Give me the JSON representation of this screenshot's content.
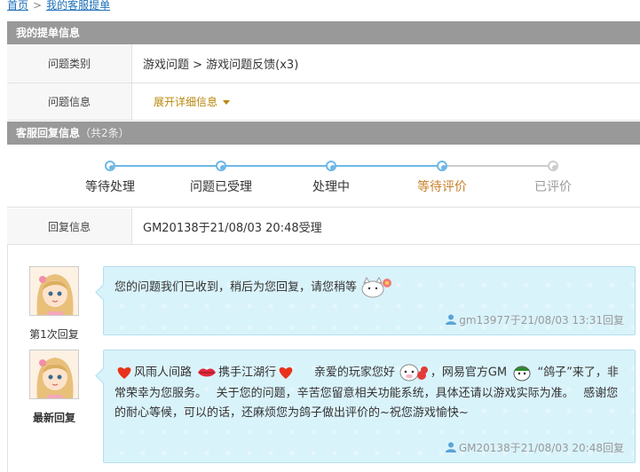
{
  "breadcrumb": {
    "home": "首页",
    "separator": ">",
    "current": "我的客服提单"
  },
  "ticket_section": {
    "title": "我的提单信息"
  },
  "fields": {
    "category_label": "问题类别",
    "category_value": "游戏问题 > 游戏问题反馈(x3)",
    "info_label": "问题信息",
    "expand_label": "展开详细信息"
  },
  "reply_section": {
    "title": "客服回复信息",
    "count": "（共2条）"
  },
  "progress": {
    "steps": [
      {
        "label": "等待处理",
        "state": "done"
      },
      {
        "label": "问题已受理",
        "state": "done"
      },
      {
        "label": "处理中",
        "state": "done"
      },
      {
        "label": "等待评价",
        "state": "current"
      },
      {
        "label": "已评价",
        "state": "pending"
      }
    ]
  },
  "reply_info": {
    "label": "回复信息",
    "value": "GM20138于21/08/03 20:48受理"
  },
  "messages": [
    {
      "avatar_caption": "第1次回复",
      "text": "您的问题我们已收到，稍后为您回复，请您稍等",
      "meta": "gm13977于21/08/03 13:31回复"
    },
    {
      "avatar_caption": "最新回复",
      "seg1": "风雨人间路",
      "seg2": "携手江湖行",
      "seg3": "亲爱的玩家您好",
      "seg4": "，网易官方GM",
      "seg5": "“鸽子”来了，非常荣幸为您服务。　 关于您的问题，辛苦您留意相关功能系统，具体还请以游戏实际为准。　 感谢您的耐心等候，可以的话，还麻烦您为鸽子做出评价的~祝您游戏愉快~",
      "meta": "GM20138于21/08/03 20:48回复"
    }
  ],
  "colors": {
    "accent_blue": "#6fb7e6",
    "bar_gray": "#999999",
    "bubble_bg": "#d9f3fb",
    "current_step": "#c8802a"
  },
  "icons": [
    "heart-icon",
    "lips-icon",
    "cat-icon",
    "cow-icon",
    "pompom-icon",
    "pigeon-icon",
    "person-icon",
    "caret-down-icon"
  ]
}
